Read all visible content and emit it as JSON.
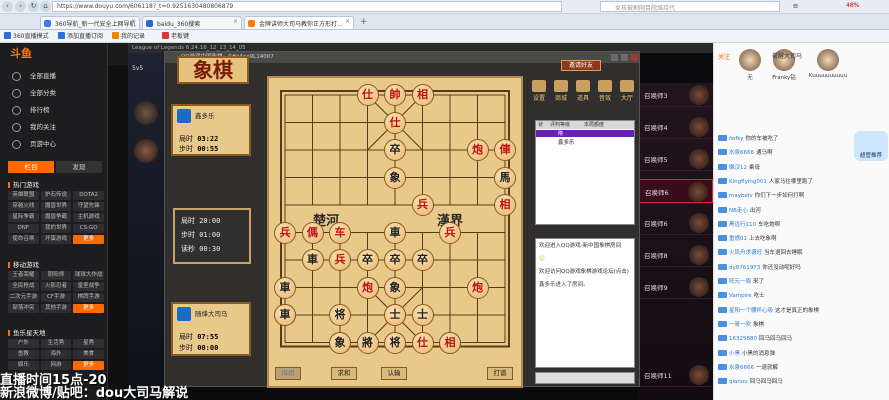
{
  "browser": {
    "url": "https://www.douyu.com/606118?_t=0.9251630480806879",
    "search_placeholder": "女孩被割网目院维持代",
    "tabs": [
      {
        "label": "360导航_新一代安全上网导航"
      },
      {
        "label": "baidu_360搜索"
      },
      {
        "label": "金牌讲师大司马教你正方形打..."
      }
    ],
    "bookmarks": [
      "360直播模式",
      "添加直播订阅",
      "我的记录",
      "老板键"
    ],
    "zoom": "48%"
  },
  "sidebar": {
    "items": [
      "全部直播",
      "全部分类",
      "排行榜",
      "我的关注",
      "页游中心"
    ],
    "tab_hot": "栏目",
    "tab_find": "发现",
    "sections": [
      {
        "title": "热门游戏",
        "games": [
          "英雄联盟",
          "炉石传说",
          "DOTA2",
          "穿越火线",
          "魔兽世界",
          "守望先锋",
          "星际争霸",
          "魔兽争霸",
          "主机游戏",
          "DNF",
          "我的世界",
          "CS:GO",
          "使命召唤",
          "坏蛋游戏",
          "更多"
        ]
      },
      {
        "title": "移动游戏",
        "games": [
          "王者荣耀",
          "阴阳师",
          "球球大作战",
          "全民枪战",
          "火影忍者",
          "皇室战争",
          "二次元手游",
          "CF手游",
          "棋牌手游",
          "部落冲突",
          "其他手游",
          "更多"
        ]
      },
      {
        "title": "鱼乐星天地",
        "games": [
          "户外",
          "生活秀",
          "星秀",
          "鱼教",
          "海外",
          "美食",
          "娱乐",
          "网游",
          "更多"
        ]
      }
    ],
    "logo": "斗鱼"
  },
  "video": {
    "lol_header": "League of Legends 6.24.16_12_13_14_05",
    "lol_score": "5v5",
    "summoners": [
      "召唤师3",
      "召唤师4",
      "召唤师5",
      "召唤师6",
      "召唤师6",
      "召唤师8",
      "召唤师9",
      "召唤师11"
    ]
  },
  "qq_game": {
    "title": "QQ游戏中国象棋 - 0#k4ea9L14007",
    "board_title": "象棋",
    "invite": "邀请好友",
    "tools": [
      "设置",
      "商城",
      "道具",
      "音效",
      "大厅"
    ],
    "player_top": {
      "name": "鑫多乐",
      "label1": "局时",
      "time1": "03:22",
      "label2": "步时",
      "time2": "00:55"
    },
    "player_bottom": {
      "name": "随烽大司马",
      "label1": "局时",
      "time1": "07:55",
      "label2": "步时",
      "time2": "00:00"
    },
    "rules": [
      {
        "label": "局时",
        "value": "20:00"
      },
      {
        "label": "步时",
        "value": "01:00"
      },
      {
        "label": "读秒",
        "value": "00:30"
      }
    ],
    "river_left": "楚河",
    "river_right": "漢界",
    "pieces": {
      "red": [
        "炮",
        "俥",
        "兵",
        "傌",
        "兵",
        "相",
        "兵",
        "俥",
        "炮",
        "仕",
        "帥",
        "相",
        "仕",
        "车",
        "马"
      ],
      "black": [
        "仕",
        "帥",
        "相",
        "仕",
        "卒",
        "馬",
        "卒",
        "車",
        "兵",
        "車",
        "卒",
        "将",
        "卒",
        "炮",
        "象",
        "士",
        "相",
        "車",
        "象",
        "將",
        "士",
        "象",
        "将",
        "車"
      ]
    },
    "buttons": [
      "悔棋",
      "求和",
      "认输",
      "打谱"
    ],
    "room_headers": [
      "状",
      "评判等级",
      "本局额度"
    ],
    "room_rows": [
      "鑫多乐"
    ],
    "room_selected": "隋",
    "chat_messages": [
      "欢迎进入QQ游戏-新中国象棋房间",
      "欢迎访问QQ游戏象棋游戏论坛(点击)",
      "鑫多乐进入了房间。"
    ]
  },
  "right_panel": {
    "follow": "关注",
    "anchors": [
      {
        "name": "无"
      },
      {
        "name": "Franky钻"
      },
      {
        "name": "Kuuuuuuuuuu"
      }
    ],
    "stream_name": "荷醒大司马",
    "chat": [
      {
        "user": "fwfky",
        "msg": "你的车被吃了"
      },
      {
        "user": "水泉6666",
        "msg": "通马啊"
      },
      {
        "user": "懒汉12",
        "msg": "乘母"
      },
      {
        "user": "Kingflying001",
        "msg": "人家马往哪里跑了"
      },
      {
        "user": "maybelv",
        "msg": "你们下一步如何打啊"
      },
      {
        "user": "NB走心",
        "msg": "出河"
      },
      {
        "user": "黑远行110",
        "msg": "车吃炮啊"
      },
      {
        "user": "重燃01",
        "msg": "上去吃象啊"
      },
      {
        "user": "火凤舟求德旺",
        "msg": "当车退回去睡眠"
      },
      {
        "user": "dy8761973",
        "msg": "你还没动呢好吗"
      },
      {
        "user": "阵元一周",
        "msg": "来了"
      },
      {
        "user": "Vampire",
        "msg": "吃士"
      },
      {
        "user": "星阳一个腰怀心吸",
        "msg": "这才是真正的象棋"
      },
      {
        "user": "一哥一吹",
        "msg": "象棋"
      },
      {
        "user": "16325880",
        "msg": "回马回马回马"
      },
      {
        "user": "小黑",
        "msg": "小黑的消息弹"
      },
      {
        "user": "水泉6666",
        "msg": "一退就解"
      },
      {
        "user": "qianou",
        "msg": "回马回马回马"
      }
    ],
    "side_badge": "超管推荐"
  },
  "overlay": {
    "line1": "直播时间15点-20",
    "line2": "新浪微博/贴吧：dou大司马解说"
  }
}
